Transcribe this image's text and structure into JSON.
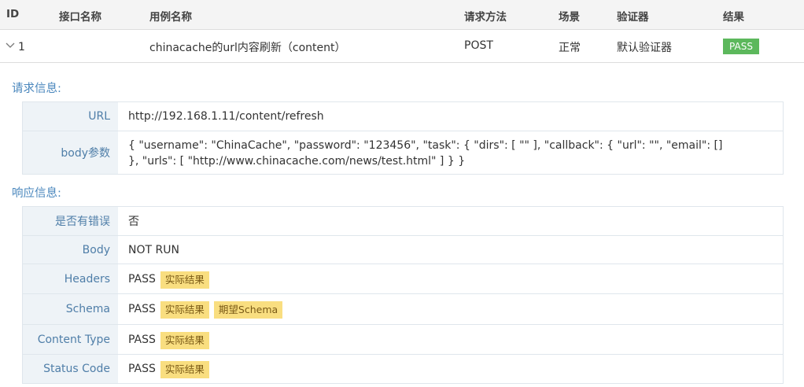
{
  "columns": {
    "id": "ID",
    "api_name": "接口名称",
    "case_name": "用例名称",
    "method": "请求方法",
    "scenario": "场景",
    "validator": "验证器",
    "result": "结果"
  },
  "case": {
    "id": "1",
    "api_name": "",
    "case_name": "chinacache的url内容刷新（content）",
    "method": "POST",
    "scenario": "正常",
    "validator": "默认验证器",
    "result": "PASS"
  },
  "request": {
    "title": "请求信息:",
    "url_label": "URL",
    "url": "http://192.168.1.11/content/refresh",
    "body_label": "body参数",
    "body": "{ \"username\": \"ChinaCache\", \"password\": \"123456\", \"task\": { \"dirs\": [ \"\" ], \"callback\": { \"url\": \"\", \"email\": [] }, \"urls\": [ \"http://www.chinacache.com/news/test.html\" ] } }"
  },
  "response": {
    "title": "响应信息:",
    "error_label": "是否有错误",
    "error_value": "否",
    "body_label": "Body",
    "body_value": "NOT RUN",
    "headers_label": "Headers",
    "headers_value": "PASS",
    "schema_label": "Schema",
    "schema_value": "PASS",
    "content_type_label": "Content Type",
    "content_type_value": "PASS",
    "status_code_label": "Status Code",
    "status_code_value": "PASS",
    "actual_result_tag": "实际结果",
    "expected_schema_tag": "期望Schema"
  },
  "colors": {
    "pass_badge": "#5cb85c",
    "section_title": "#4a87bd",
    "label_bg": "#eef3f7",
    "tag_bg": "#f9de80"
  },
  "icons": {
    "expand": "chevron-down-icon"
  }
}
